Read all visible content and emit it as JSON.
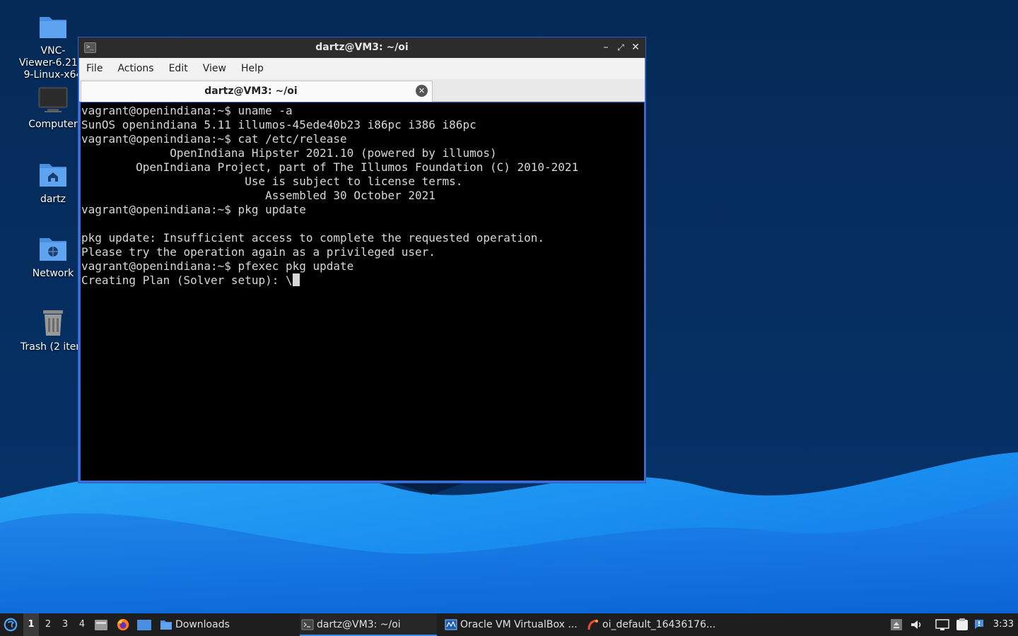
{
  "desktop": {
    "icons": [
      {
        "label": "VNC-\nViewer-6.21.1\n9-Linux-x64",
        "icon": "folder-icon"
      },
      {
        "label": "Computer",
        "icon": "computer-icon"
      },
      {
        "label": "dartz",
        "icon": "home-folder-icon"
      },
      {
        "label": "Network",
        "icon": "network-folder-icon"
      },
      {
        "label": "Trash (2 item",
        "icon": "trash-icon"
      }
    ]
  },
  "window": {
    "title": "dartz@VM3: ~/oi",
    "menu": [
      "File",
      "Actions",
      "Edit",
      "View",
      "Help"
    ],
    "tab_label": "dartz@VM3: ~/oi",
    "terminal_lines": [
      "vagrant@openindiana:~$ uname -a",
      "SunOS openindiana 5.11 illumos-45ede40b23 i86pc i386 i86pc",
      "vagrant@openindiana:~$ cat /etc/release",
      "             OpenIndiana Hipster 2021.10 (powered by illumos)",
      "        OpenIndiana Project, part of The Illumos Foundation (C) 2010-2021",
      "                        Use is subject to license terms.",
      "                           Assembled 30 October 2021",
      "vagrant@openindiana:~$ pkg update",
      "",
      "pkg update: Insufficient access to complete the requested operation.",
      "Please try the operation again as a privileged user.",
      "vagrant@openindiana:~$ pfexec pkg update"
    ],
    "current_line": "Creating Plan (Solver setup): \\"
  },
  "taskbar": {
    "workspaces": [
      "1",
      "2",
      "3",
      "4"
    ],
    "active_workspace": "1",
    "tasks": [
      {
        "label": "Downloads",
        "icon": "folder-icon"
      },
      {
        "label": "dartz@VM3: ~/oi",
        "icon": "terminal-icon"
      },
      {
        "label": "Oracle VM VirtualBox ...",
        "icon": "virtualbox-icon"
      },
      {
        "label": "oi_default_16436176...",
        "icon": "app-icon"
      }
    ],
    "clock": "3:33"
  },
  "colors": {
    "desktop_dark": "#062b58",
    "wave_light": "#1c8cf0",
    "window_border": "#3b6fd6",
    "taskbar": "#1e1e1e",
    "accent": "#3d8eea"
  }
}
